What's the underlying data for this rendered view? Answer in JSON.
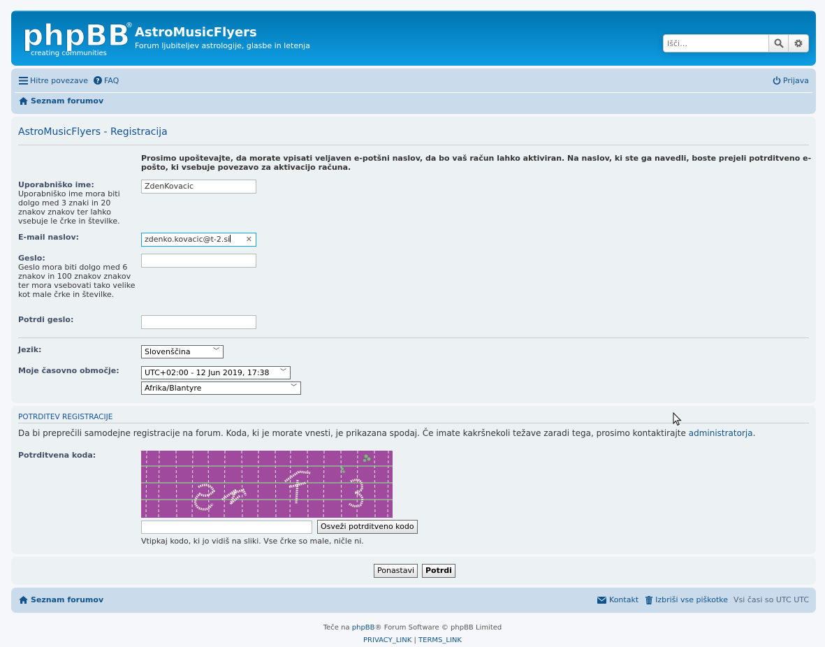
{
  "header": {
    "logo_text": "phpBB",
    "logo_tag": "creating communities",
    "site_title": "AstroMusicFlyers",
    "site_description": "Forum ljubiteljev astrologije, glasbe in letenja",
    "search_placeholder": "Išči…"
  },
  "navbar": {
    "quick_links": "Hitre povezave",
    "faq": "FAQ",
    "login": "Prijava",
    "breadcrumb_home": "Seznam forumov"
  },
  "registration": {
    "title": "AstroMusicFlyers - Registracija",
    "notice": "Prosimo upoštevajte, da morate vpisati veljaven e-potšni naslov, da bo vaš račun lahko aktiviran. Na naslov, ki ste ga navedli, boste prejeli potrditveno e-pošto, ki vsebuje povezavo za aktivacijo računa.",
    "username_label": "Uporabniško ime:",
    "username_explain": "Uporabniško ime mora biti dolgo med 3 znaki in 20 znakov znakov ter lahko vsebuje le črke in številke.",
    "username_value": "ZdenKovacic",
    "email_label": "E-mail naslov:",
    "email_value": "zdenko.kovacic@t-2.si",
    "password_label": "Geslo:",
    "password_explain": "Geslo mora biti dolgo med 6 znakov in 100 znakov znakov ter mora vsebovati tako velike kot male črke in številke.",
    "password_confirm_label": "Potrdi geslo:",
    "language_label": "Jezik:",
    "language_value": "Slovenščina",
    "timezone_label": "Moje časovno območje:",
    "timezone_value": "UTC+02:00 - 12 Jun 2019, 17:38",
    "timezone_region": "Afrika/Blantyre"
  },
  "captcha": {
    "title": "POTRDITEV REGISTRACIJE",
    "text_before": "Da bi preprečili samodejne registracije na forum. Koda, ki je morate vnesti, je prikazana spodaj. Če imate kakršnekoli težave zaradi tega, prosimo kontaktirajte ",
    "admin_link": "administratorja",
    "text_after": ".",
    "code_label": "Potrditvena koda:",
    "refresh_button": "Osveži potrditveno kodo",
    "hint": "Vtipkaj kodo, ki jo vidiš na sliki. Vse črke so male, ničle ni."
  },
  "submit": {
    "reset_button": "Ponastavi",
    "submit_button": "Potrdi"
  },
  "footer": {
    "home": "Seznam forumov",
    "contact": "Kontakt",
    "delete_cookies": "Izbriši vse piškotke",
    "timezone_note": "Vsi časi so UTC UTC",
    "powered_before": "Teče na ",
    "powered_link": "phpBB",
    "powered_after": "® Forum Software © phpBB Limited",
    "privacy_link": "PRIVACY_LINK",
    "terms_link": "TERMS_LINK",
    "link_separator": "|"
  },
  "colors": {
    "header_blue": "#12a3eb",
    "navbar_bg": "#cadceb",
    "panel_bg": "#ecf1f3",
    "link": "#105289",
    "captcha_bg": "#a04a9e"
  }
}
